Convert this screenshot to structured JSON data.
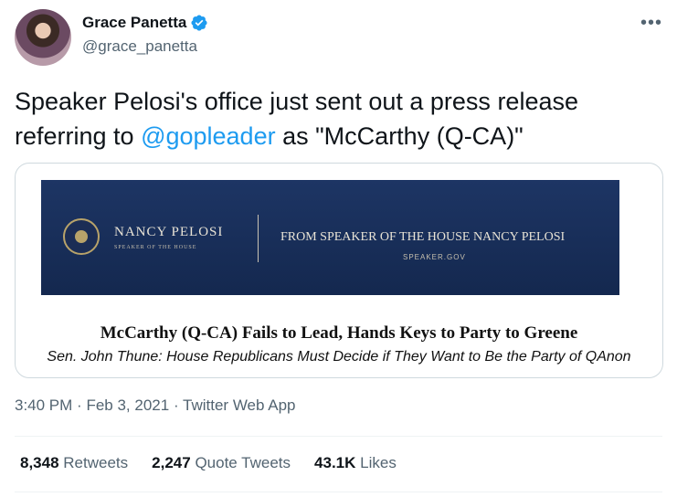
{
  "author": {
    "display_name": "Grace Panetta",
    "handle": "@grace_panetta",
    "verified_icon": "verified-badge-icon"
  },
  "more_label": "•••",
  "tweet": {
    "text_before": "Speaker Pelosi's office just sent out a press release referring to ",
    "mention": "@gopleader",
    "text_after": " as \"McCarthy (Q-CA)\""
  },
  "card": {
    "banner_name": "NANCY PELOSI",
    "banner_sub": "SPEAKER OF THE HOUSE",
    "banner_from": "FROM SPEAKER OF THE HOUSE NANCY PELOSI",
    "banner_site": "SPEAKER.GOV",
    "headline": "McCarthy (Q-CA) Fails to Lead, Hands Keys to Party to Greene",
    "subhead": "Sen. John Thune: House Republicans Must Decide if They Want to Be the Party of QAnon"
  },
  "meta": {
    "time": "3:40 PM",
    "date": "Feb 3, 2021",
    "app": "Twitter Web App",
    "sep": "·"
  },
  "stats": {
    "retweets_count": "8,348",
    "retweets_label": "Retweets",
    "quotes_count": "2,247",
    "quotes_label": "Quote Tweets",
    "likes_count": "43.1K",
    "likes_label": "Likes"
  },
  "colors": {
    "accent": "#1d9bf0",
    "banner": "#1d3564"
  }
}
